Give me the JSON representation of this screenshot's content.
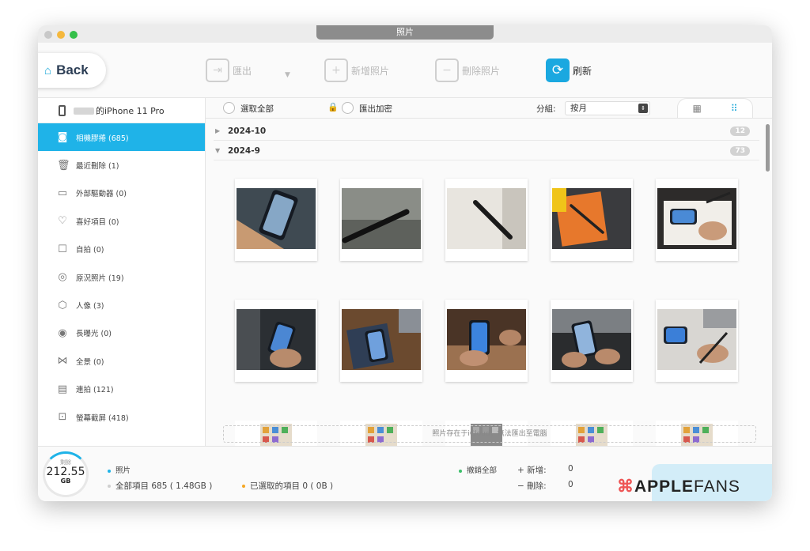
{
  "window": {
    "title": "照片"
  },
  "toolbar": {
    "back_label": "Back",
    "export_label": "匯出",
    "add_label": "新增照片",
    "delete_label": "刪除照片",
    "refresh_label": "刷新"
  },
  "sidebar": {
    "device_name": "的iPhone 11 Pro",
    "items": [
      {
        "label": "相機膠捲 (685)",
        "icon": "camera-icon"
      },
      {
        "label": "最近刪除 (1)",
        "icon": "trash-icon"
      },
      {
        "label": "外部驅動器 (0)",
        "icon": "drive-icon"
      },
      {
        "label": "喜好項目 (0)",
        "icon": "heart-icon"
      },
      {
        "label": "自拍 (0)",
        "icon": "selfie-icon"
      },
      {
        "label": "原況照片 (19)",
        "icon": "live-photo-icon"
      },
      {
        "label": "人像 (3)",
        "icon": "cube-icon"
      },
      {
        "label": "長曝光 (0)",
        "icon": "long-exposure-icon"
      },
      {
        "label": "全景 (0)",
        "icon": "panorama-icon"
      },
      {
        "label": "連拍 (121)",
        "icon": "burst-icon"
      },
      {
        "label": "螢幕截屏 (418)",
        "icon": "screenshot-icon"
      }
    ]
  },
  "content": {
    "select_all_label": "選取全部",
    "export_encrypt_label": "匯出加密",
    "group_label": "分組:",
    "group_value": "按月",
    "groups": [
      {
        "date": "2024-10",
        "count": "12"
      },
      {
        "date": "2024-9",
        "count": "73"
      }
    ],
    "icloud_notice": "照片存在于iCloud，無法匯出至電腦"
  },
  "footer": {
    "storage_label": "剩餘",
    "storage_value": "212.55",
    "storage_unit": "GB",
    "category_label": "照片",
    "total_items": "全部項目 685 ( 1.48GB )",
    "selected_items": "已選取的項目 0 ( 0B )",
    "undo_all_label": "撤銷全部",
    "added_label": "+ 新增:",
    "added_value": "0",
    "deleted_label": "− 刪除:",
    "deleted_value": "0",
    "brand_apple": "APPLE",
    "brand_fans": "FANS"
  },
  "colors": {
    "accent": "#1fb3e8",
    "lock": "#f2a024",
    "selected_dot": "#f5a623",
    "undo_dot": "#3cbf6a"
  }
}
